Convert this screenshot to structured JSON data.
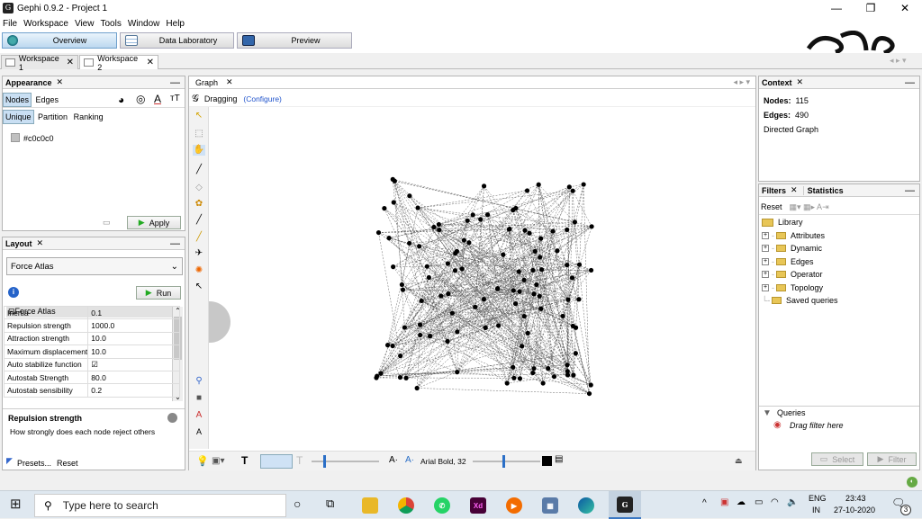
{
  "window": {
    "title": "Gephi 0.9.2 - Project 1",
    "logo_text": "G",
    "minimize": "—",
    "restore": "❐",
    "close": "✕"
  },
  "menu": [
    "File",
    "Workspace",
    "View",
    "Tools",
    "Window",
    "Help"
  ],
  "modes": {
    "overview": "Overview",
    "data_lab": "Data Laboratory",
    "preview": "Preview"
  },
  "workspaces": [
    {
      "label": "Workspace 1"
    },
    {
      "label": "Workspace 2"
    }
  ],
  "appearance": {
    "title": "Appearance",
    "tabs": [
      "Nodes",
      "Edges"
    ],
    "subtabs": [
      "Unique",
      "Partition",
      "Ranking"
    ],
    "color_value": "#c0c0c0",
    "apply": "Apply"
  },
  "layout": {
    "title": "Layout",
    "algorithm": "Force Atlas",
    "run": "Run",
    "section": "Force Atlas",
    "properties": [
      {
        "name": "Inertia",
        "value": "0.1"
      },
      {
        "name": "Repulsion strength",
        "value": "1000.0"
      },
      {
        "name": "Attraction strength",
        "value": "10.0"
      },
      {
        "name": "Maximum displacement",
        "value": "10.0"
      },
      {
        "name": "Auto stabilize function",
        "value": "☑"
      },
      {
        "name": "Autostab Strength",
        "value": "80.0"
      },
      {
        "name": "Autostab sensibility",
        "value": "0.2"
      }
    ],
    "desc_title": "Repulsion strength",
    "desc_text": "How strongly does each node reject others",
    "presets": "Presets...",
    "reset": "Reset"
  },
  "graph": {
    "tab": "Graph",
    "mode": "Dragging",
    "configure": "(Configure)",
    "font_label": "Arial Bold, 32"
  },
  "context": {
    "title": "Context",
    "nodes_label": "Nodes:",
    "nodes_value": "115",
    "edges_label": "Edges:",
    "edges_value": "490",
    "graph_type": "Directed Graph"
  },
  "filters": {
    "tab_filters": "Filters",
    "tab_statistics": "Statistics",
    "reset": "Reset",
    "library": "Library",
    "items": [
      "Attributes",
      "Dynamic",
      "Edges",
      "Operator",
      "Topology",
      "Saved queries"
    ],
    "queries": "Queries",
    "drag_hint": "Drag filter here",
    "select": "Select",
    "filter": "Filter"
  },
  "taskbar": {
    "search_placeholder": "Type here to search",
    "lang1": "ENG",
    "lang2": "IN",
    "time": "23:43",
    "date": "27-10-2020",
    "notif_count": "3",
    "xd_label": "Xd"
  }
}
